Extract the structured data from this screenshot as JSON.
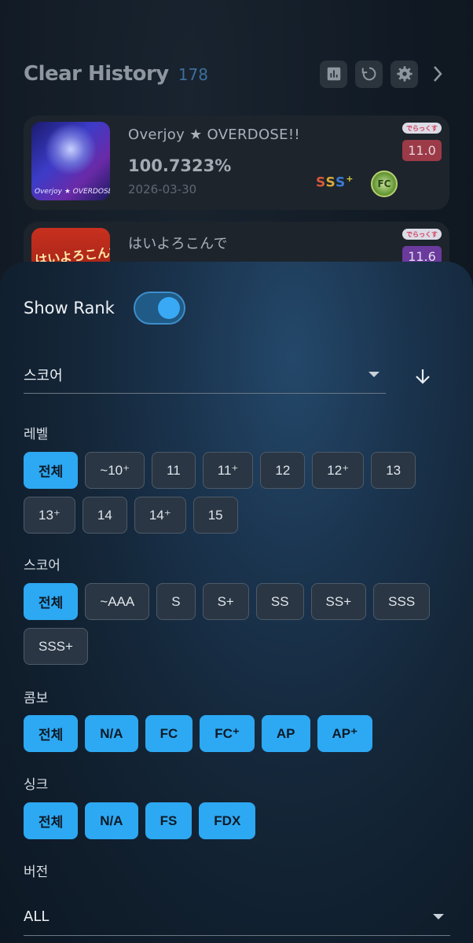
{
  "header": {
    "title": "Clear History",
    "count": "178",
    "actions": [
      "stats-icon",
      "refresh-icon",
      "gear-icon",
      "chevron-right-icon"
    ]
  },
  "cards": [
    {
      "title": "Overjoy ★ OVERDOSE!!",
      "score": "100.7323%",
      "date": "2026-03-30",
      "jacket_text": "Overjoy ★ OVERDOSE!!",
      "difficulty_tag": "でらっくす",
      "level": "11.0",
      "rank": "SSS+",
      "combo": "FC"
    },
    {
      "title": "はいよろこんで",
      "jacket_text": "はいよろこんで",
      "difficulty_tag": "でらっくす",
      "level": "11.6"
    }
  ],
  "sheet": {
    "show_rank_label": "Show Rank",
    "show_rank_on": true,
    "sort_select": "스코어",
    "sort_direction_icon": "arrow-down-icon",
    "level": {
      "label": "레벨",
      "chips": [
        "전체",
        "~10⁺",
        "11",
        "11⁺",
        "12",
        "12⁺",
        "13",
        "13⁺",
        "14",
        "14⁺",
        "15"
      ],
      "selected": 0
    },
    "score": {
      "label": "스코어",
      "chips": [
        "전체",
        "~AAA",
        "S",
        "S+",
        "SS",
        "SS+",
        "SSS",
        "SSS+"
      ],
      "selected": 0
    },
    "combo": {
      "label": "콤보",
      "chips": [
        "전체",
        "N/A",
        "FC",
        "FC⁺",
        "AP",
        "AP⁺"
      ]
    },
    "sync": {
      "label": "싱크",
      "chips": [
        "전체",
        "N/A",
        "FS",
        "FDX"
      ]
    },
    "version": {
      "label": "버전",
      "value": "ALL"
    }
  },
  "colors": {
    "accent": "#2da8f2",
    "sheet_bg": "#142638",
    "chip_bg": "#2a3643"
  }
}
